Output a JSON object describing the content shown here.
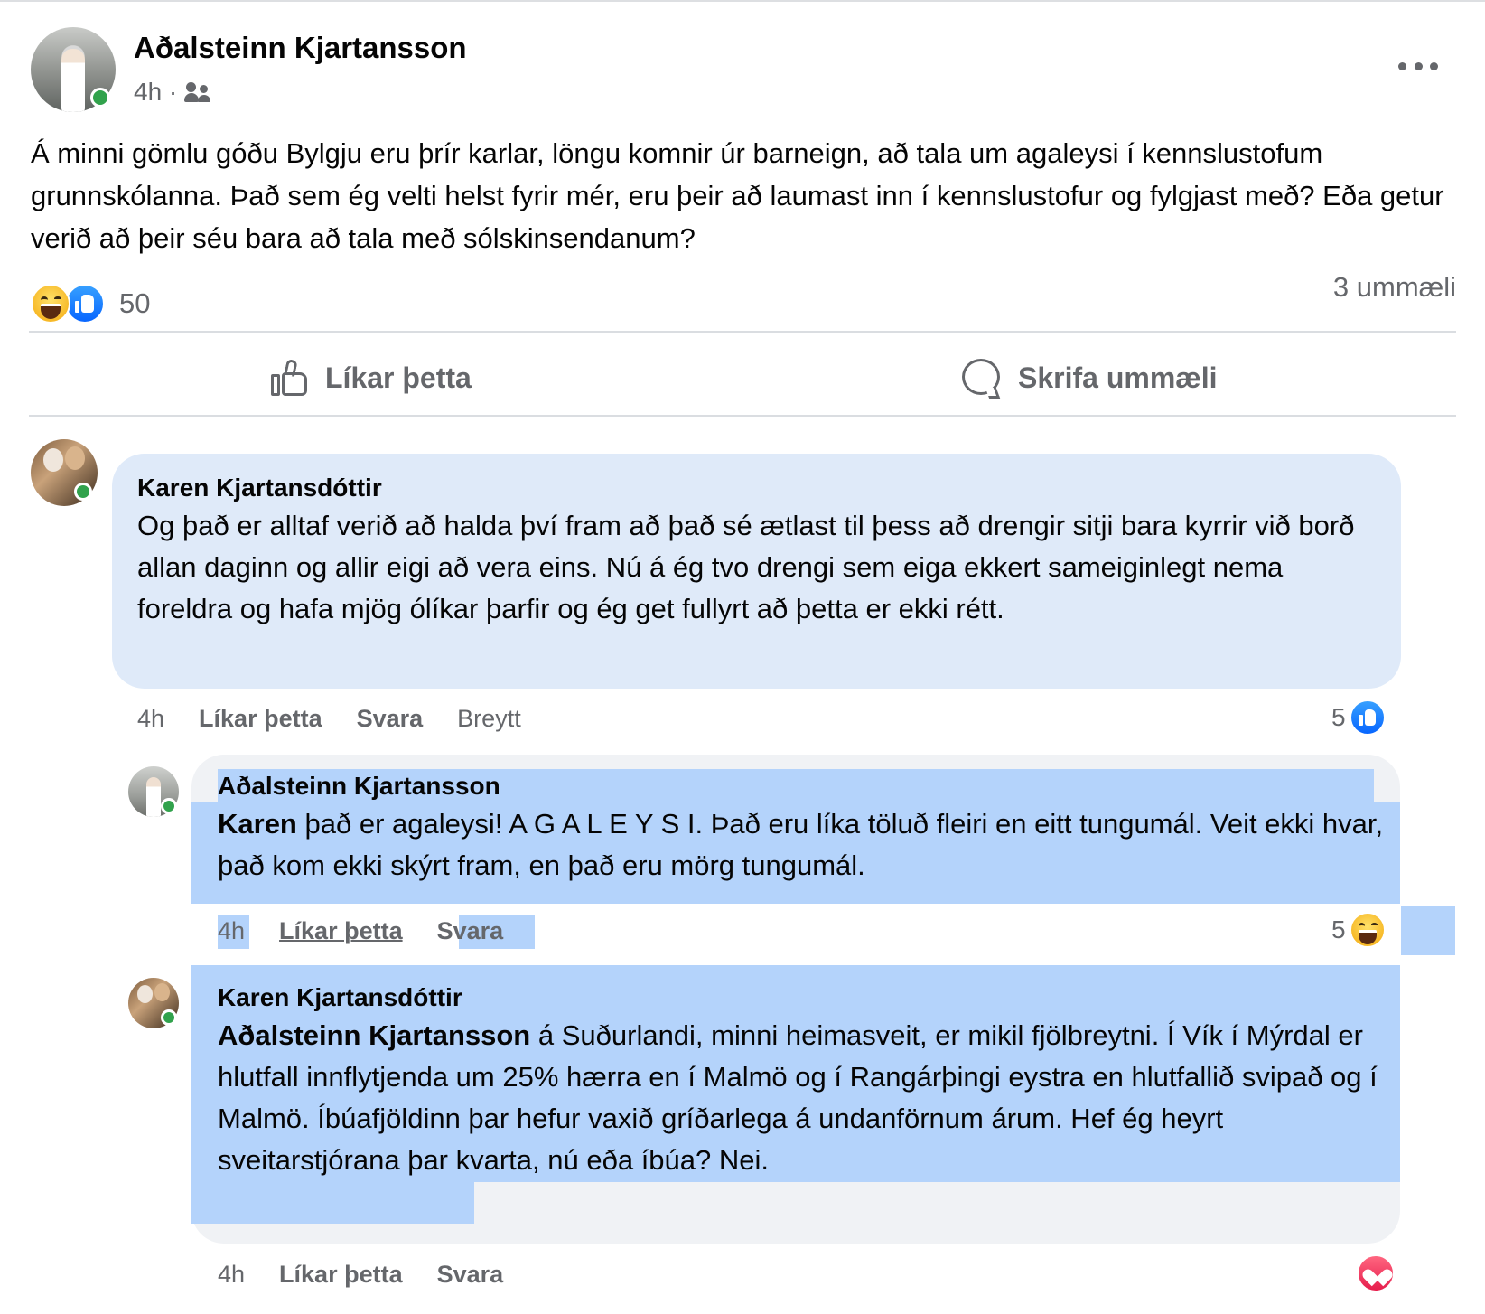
{
  "post": {
    "author": "Aðalsteinn Kjartansson",
    "time": "4h ·",
    "audience_icon": "friends-icon",
    "text": "Á minni gömlu góðu Bylgju eru þrír karlar, löngu komnir úr barneign, að tala um agaleysi í kennslustofum grunnskólanna. Það sem ég velti helst fyrir mér, eru þeir að laumast inn í kennslustofur og fylgjast með? Eða getur verið að þeir séu bara að tala með sólskinsendanum?",
    "reactions": {
      "icons": [
        "haha",
        "like"
      ],
      "count": "50"
    },
    "comment_count": "3 ummæli",
    "actions": {
      "like": "Líkar þetta",
      "comment": "Skrifa ummæli"
    }
  },
  "comments": [
    {
      "author": "Karen Kjartansdóttir",
      "text": "Og það er alltaf verið að halda því fram að það sé ætlast til þess að drengir sitji bara kyrrir við borð allan daginn og allir eigi að vera eins. Nú á ég tvo drengi sem eiga ekkert sameiginlegt nema foreldra og hafa mjög ólíkar þarfir og ég get fullyrt að þetta er ekki rétt.",
      "time": "4h",
      "like": "Líkar þetta",
      "reply": "Svara",
      "edited": "Breytt",
      "reaction_count": "5",
      "reaction_icon": "like"
    },
    {
      "author": "Aðalsteinn Kjartansson",
      "mention": "Karen",
      "text": " það er agaleysi! A G A L E Y S I. Það eru líka töluð fleiri en eitt tungumál. Veit ekki hvar, það kom ekki skýrt fram, en það eru mörg tungumál.",
      "time": "4h",
      "like": "Líkar þetta",
      "reply": "Svara",
      "reaction_count": "5",
      "reaction_icon": "haha"
    },
    {
      "author": "Karen Kjartansdóttir",
      "mention": "Aðalsteinn Kjartansson",
      "text": " á Suðurlandi, minni heimasveit, er mikil fjölbreytni. Í Vík í Mýrdal er hlutfall innflytjenda um 25% hærra en í Malmö og í Rangárþingi eystra en hlutfallið svipað og í Malmö. Íbúafjöldinn þar hefur vaxið gríðarlega á undanförnum árum. Hef ég heyrt sveitarstjórana þar kvarta, nú eða íbúa? Nei.",
      "time": "4h",
      "like": "Líkar þetta",
      "reply": "Svara",
      "reaction_icon": "love"
    }
  ],
  "colors": {
    "accent": "#0866ff",
    "selection": "#b4d3fb",
    "bubble": "#f0f2f5",
    "bubble_highlight": "#dfeaf9",
    "muted_text": "#65676b",
    "online": "#31a24c"
  }
}
